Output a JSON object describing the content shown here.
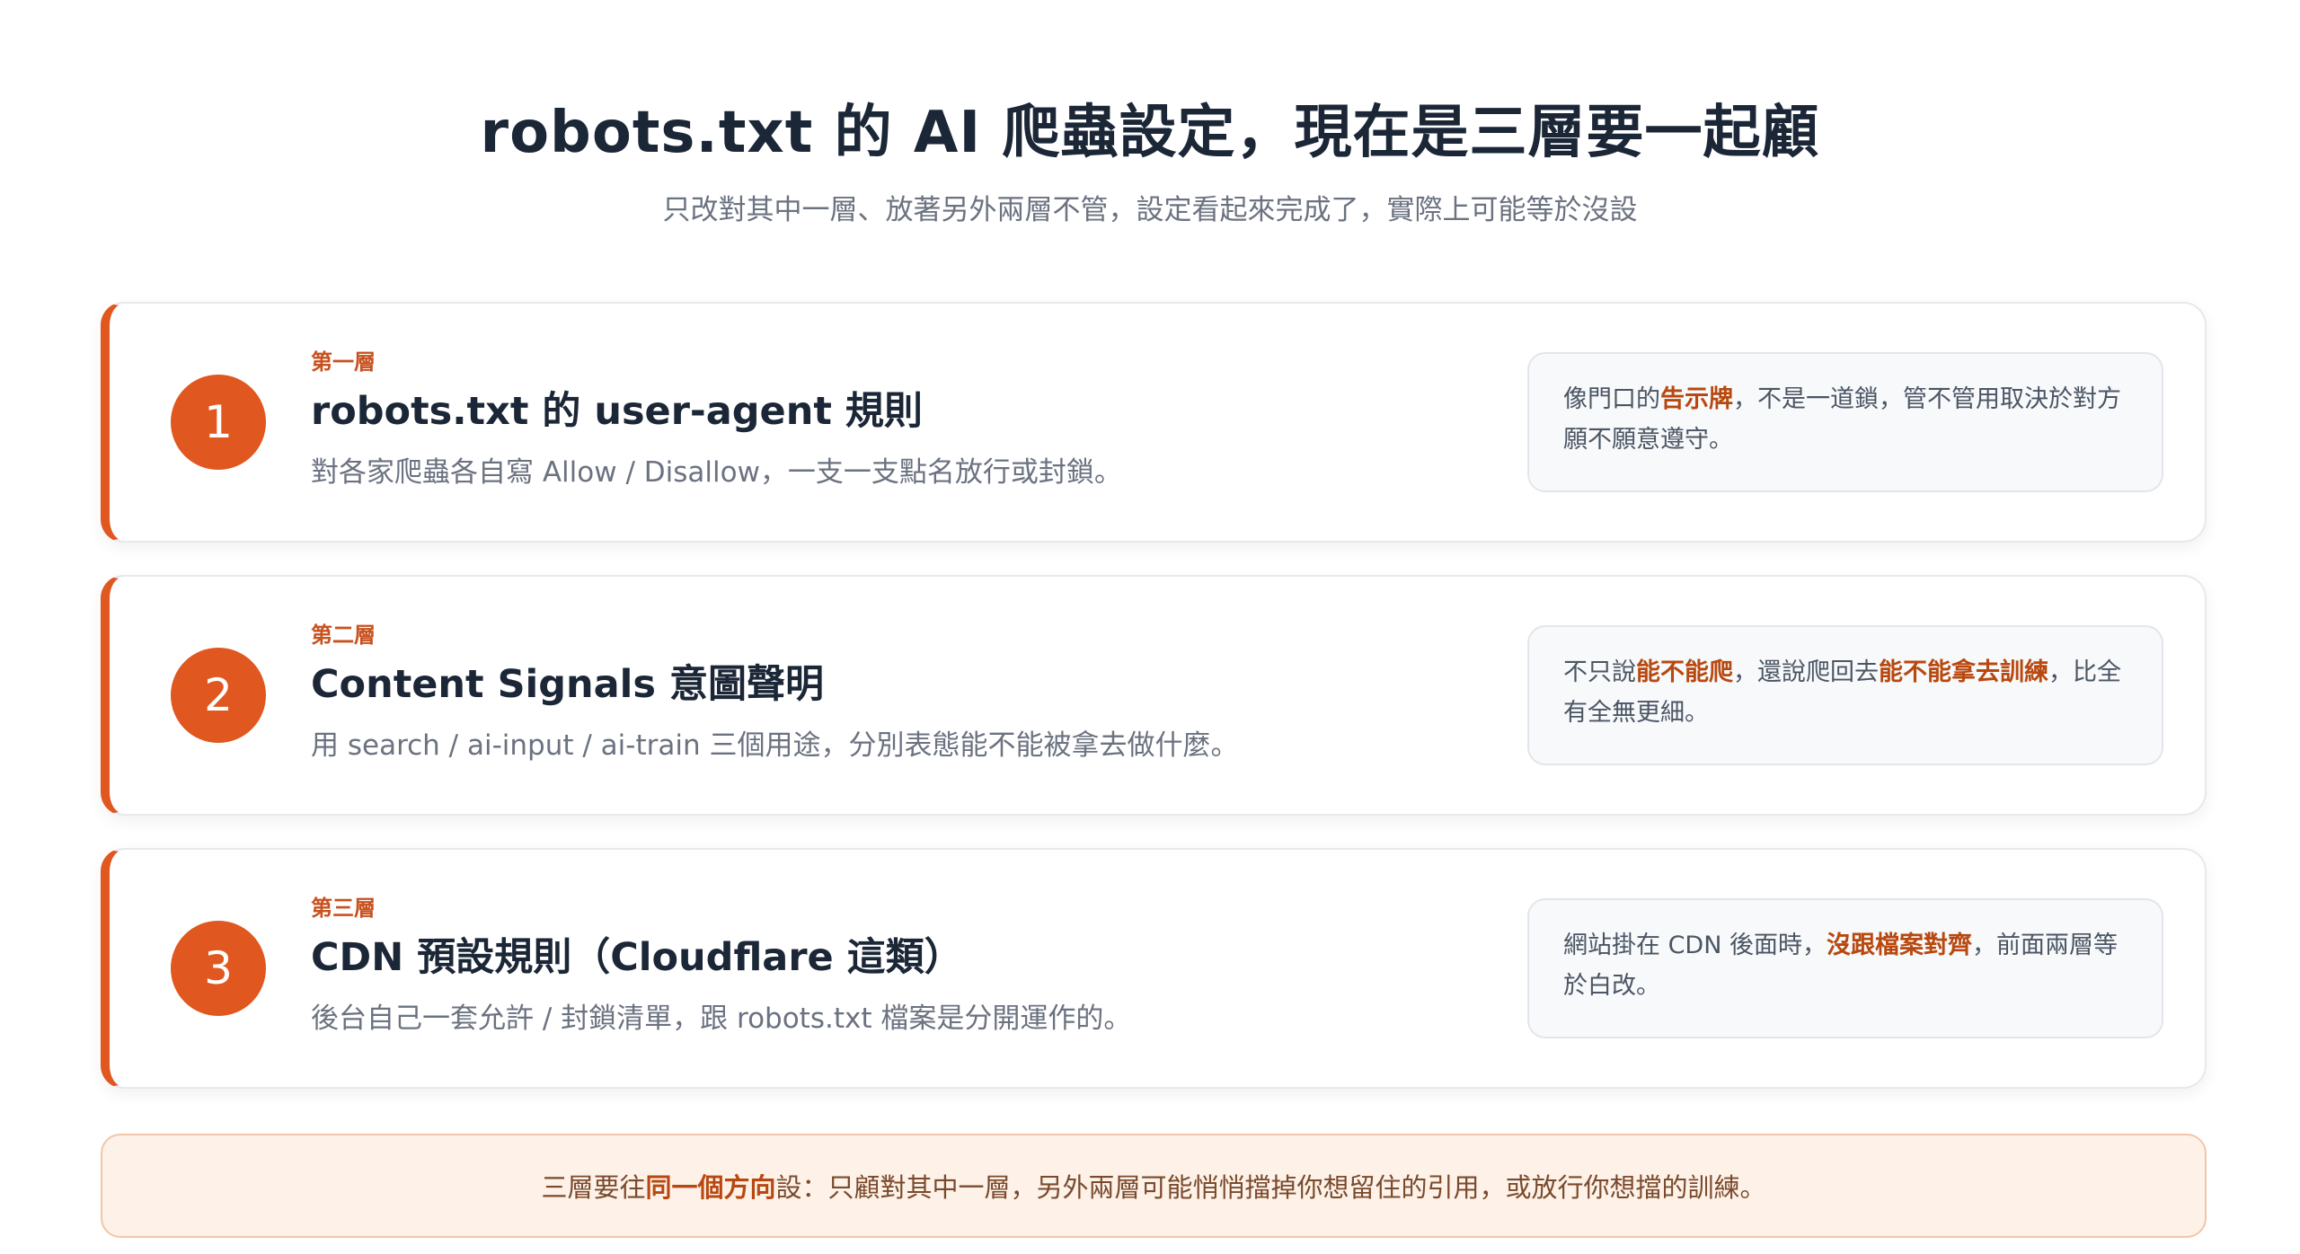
{
  "header": {
    "title": "robots.txt 的 AI 爬蟲設定，現在是三層要一起顧",
    "subtitle": "只改對其中一層、放著另外兩層不管，設定看起來完成了，實際上可能等於沒設"
  },
  "layers": [
    {
      "number": "1",
      "label": "第一層",
      "title": "robots.txt 的 user-agent 規則",
      "description": "對各家爬蟲各自寫 Allow / Disallow，一支一支點名放行或封鎖。",
      "note": {
        "pre": "像門口的",
        "hl1": "告示牌",
        "mid": "，不是一道鎖，管不管用取決於對方願不願意遵守。",
        "hl2": "",
        "post": ""
      }
    },
    {
      "number": "2",
      "label": "第二層",
      "title": "Content Signals 意圖聲明",
      "description": "用 search / ai-input / ai-train 三個用途，分別表態能不能被拿去做什麼。",
      "note": {
        "pre": "不只說",
        "hl1": "能不能爬",
        "mid": "，還說爬回去",
        "hl2": "能不能拿去訓練",
        "post": "，比全有全無更細。"
      }
    },
    {
      "number": "3",
      "label": "第三層",
      "title": "CDN 預設規則（Cloudflare 這類）",
      "description": "後台自己一套允許 / 封鎖清單，跟 robots.txt 檔案是分開運作的。",
      "note": {
        "pre": "網站掛在 CDN 後面時，",
        "hl1": "沒跟檔案對齊",
        "mid": "，前面兩層等於白改。",
        "hl2": "",
        "post": ""
      }
    }
  ],
  "footer": {
    "pre": "三層要往",
    "hl": "同一個方向",
    "post": "設：只顧對其中一層，另外兩層可能悄悄擋掉你想留住的引用，或放行你想擋的訓練。"
  },
  "colors": {
    "accent": "#e0571f",
    "highlight_text": "#b8480f",
    "title_text": "#1b2636",
    "muted_text": "#6b7280",
    "footer_bg": "#fdf1e8"
  }
}
